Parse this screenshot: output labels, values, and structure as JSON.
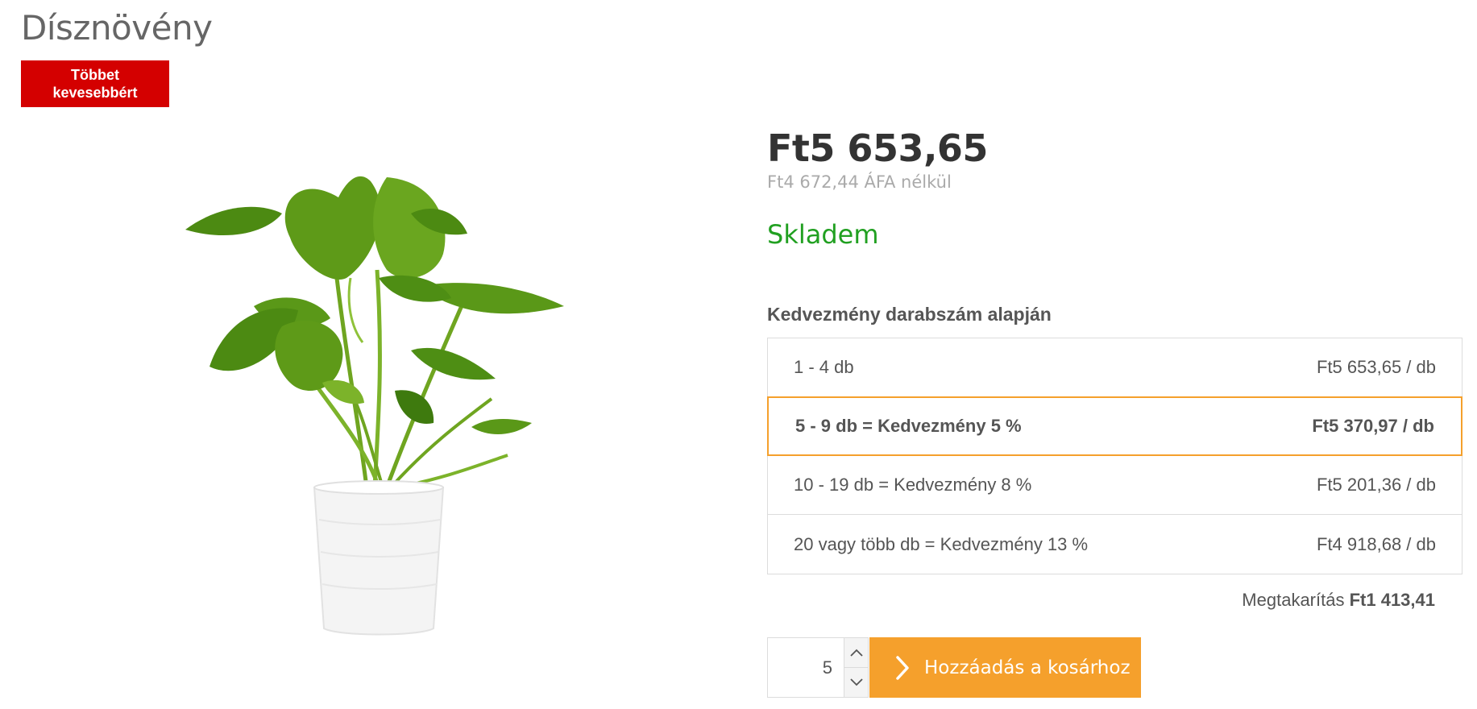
{
  "page": {
    "title": "Dísznövény"
  },
  "badge": {
    "label": "Többet kevesebbért"
  },
  "product": {
    "image_alt": "Dísznövény",
    "price": "Ft5 653,65",
    "price_net": "Ft4 672,44 ÁFA nélkül",
    "stock": "Skladem"
  },
  "discounts": {
    "heading": "Kedvezmény darabszám alapján",
    "rows": [
      {
        "range": "1 - 4 db",
        "price": "Ft5 653,65 / db",
        "active": false
      },
      {
        "range": "5 - 9 db = Kedvezmény 5 %",
        "price": "Ft5 370,97 / db",
        "active": true
      },
      {
        "range": "10 - 19 db = Kedvezmény 8 %",
        "price": "Ft5 201,36 / db",
        "active": false
      },
      {
        "range": "20 vagy több db = Kedvezmény 13 %",
        "price": "Ft4 918,68 / db",
        "active": false
      }
    ]
  },
  "savings": {
    "label": "Megtakarítás",
    "value": "Ft1 413,41"
  },
  "cart": {
    "quantity": "5",
    "add_label": "Hozzáadás a kosárhoz"
  },
  "colors": {
    "badge": "#d40000",
    "stock": "#21a021",
    "accent": "#f5a02c"
  },
  "icons": {
    "increment": "chevron-up-icon",
    "decrement": "chevron-down-icon",
    "add": "chevron-right-icon"
  }
}
